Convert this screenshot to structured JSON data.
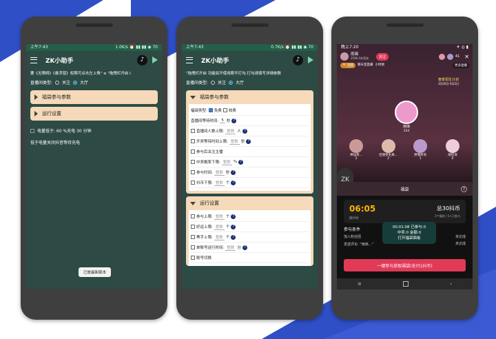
{
  "colors": {
    "accent": "#2d4a44",
    "panel": "#f5d9b8",
    "blue": "#2f4fc7",
    "live_red": "#e03a57"
  },
  "phone1": {
    "status_time": "上午7:43",
    "status_right": "1.0K/s ⏰ ▮▮ ▮▮ ◉ 70",
    "app_title": "ZK小助手",
    "notice": "要《无障碍》《悬浮窗》权限可点击左上角\" ≡ \"拖拽栏开启  I",
    "room_type_label": "直播间类型:",
    "opt_follow": "关注",
    "opt_hall": "大厅",
    "panel1": "福袋参与参数",
    "panel2": "运行设置",
    "battery_label": "电量低于: 60 %充电 30 分钟",
    "low_battery": "低于电量关闭抖音等待充电",
    "toast": "已是最新版本"
  },
  "phone2": {
    "status_time": "上午7:43",
    "status_right": "0.7K/s ⏰ ▮▮ ▮▮ ◉ 70",
    "app_title": "ZK小助手",
    "notice": "\"拖拽栏开启  功能如不使用刚不打勾.打勾请填写详细参数",
    "room_type_label": "直播间类型:",
    "opt_follow": "关注",
    "opt_hall": "大厅",
    "sec1": "福袋参与参数",
    "bag_type": "福袋类型:",
    "free": "免费",
    "paid": "收费",
    "wait_time": "直播间等待时间:",
    "wait_val": "5",
    "unit_sec": "秒",
    "rows1": [
      {
        "label": "直播间人数上限:",
        "ph": "整数",
        "unit": "人"
      },
      {
        "label": "开奖等待时间上限:",
        "ph": "整数",
        "unit": "秒"
      },
      {
        "label": "参与后关注主播",
        "ph": "",
        "unit": ""
      },
      {
        "label": "中奖概率下限:",
        "ph": "整数",
        "unit": "%"
      },
      {
        "label": "参与时间:",
        "ph": "整数",
        "unit": "秒"
      },
      {
        "label": "抖币下限:",
        "ph": "整数",
        "unit": "个"
      }
    ],
    "sec2": "运行设置",
    "rows2": [
      {
        "label": "参与上限:",
        "ph": "整数",
        "unit": "个"
      },
      {
        "label": "好运上限:",
        "ph": "整数",
        "unit": "个"
      },
      {
        "label": "黑手上限:",
        "ph": "整数",
        "unit": "个"
      },
      {
        "label": "单账号运行时间:",
        "ph": "整数",
        "unit": "分"
      },
      {
        "label": "账号切换",
        "ph": "",
        "unit": ""
      }
    ]
  },
  "phone3": {
    "status_time": "晚上7:20",
    "host_name": "雨璃",
    "host_sub": "2596.4本音浪",
    "follow": "关注",
    "viewer_count": "41",
    "tag1": "🏆 活跃",
    "tag2": "聊天室直播",
    "tag3": "小时榜",
    "more": "更多直播",
    "event": "春季招生计划",
    "event_sub": "3月26日-4月2日",
    "center_name": "雨璃",
    "center_count": "224",
    "guests": [
      {
        "name": "神仙哥…",
        "count": "2"
      },
      {
        "name": "佳丽参生来…",
        "count": "2"
      },
      {
        "name": "胖我所有",
        "count": "1"
      },
      {
        "name": "胡佳涛",
        "count": "0"
      }
    ],
    "float_logo": "ZK",
    "bag_title": "福袋",
    "countdown": "06:05",
    "countdown_label": "倒计时",
    "total": "总30抖币",
    "total_sub": "3个福袋 | 5人已参与",
    "cond_title": "参与条件",
    "cond1": "加入粉丝团",
    "cond2": "发送评论: \"雨璃…\"",
    "cond_state1": "未达成",
    "cond_state2": "未达成",
    "overlay1": "00:01:08  已参与:0",
    "overlay2": "中奖:0  金额:0",
    "overlay3": "打开福袋面板",
    "cta": "一键参与获取福袋(支付1抖币)"
  }
}
